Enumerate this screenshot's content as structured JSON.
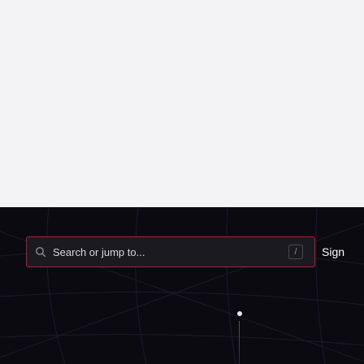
{
  "header": {
    "search": {
      "placeholder": "Search or jump to...",
      "shortcut_key": "/"
    },
    "signin_label": "Sign"
  },
  "icons": {
    "search": "search-icon",
    "scroll": "scroll-indicator-dot"
  },
  "colors": {
    "page_top": "#f3f2f4",
    "hero_background": "#0b0a10",
    "search_border": "#a72136",
    "search_background": "#1b1a20",
    "text": "#ffffff"
  }
}
